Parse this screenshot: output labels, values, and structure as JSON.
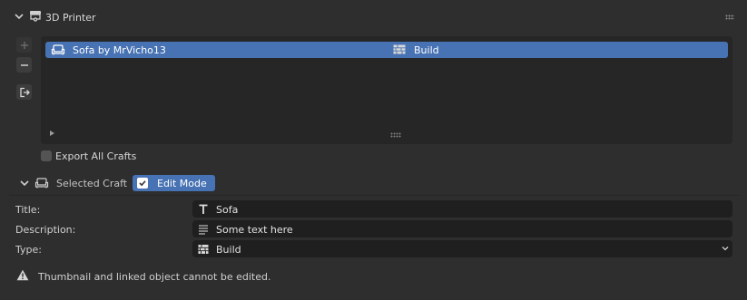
{
  "panel": {
    "title": "3D Printer",
    "header_icon": "printer-icon"
  },
  "side_buttons": [
    {
      "name": "add-button",
      "icon": "plus-icon"
    },
    {
      "name": "remove-button",
      "icon": "minus-icon"
    },
    {
      "name": "export-button",
      "icon": "export-icon"
    }
  ],
  "craft_list": {
    "items": [
      {
        "label": "Sofa by MrVicho13",
        "type": "Build",
        "icon": "sofa-icon",
        "type_icon": "brick-icon",
        "selected": true
      }
    ]
  },
  "export_all": {
    "label": "Export All Crafts",
    "checked": false
  },
  "selected_craft": {
    "label": "Selected Craft",
    "edit_mode": {
      "label": "Edit Mode",
      "checked": true
    }
  },
  "fields": {
    "title": {
      "label": "Title:",
      "value": "Sofa",
      "icon": "text-icon"
    },
    "description": {
      "label": "Description:",
      "value": "Some text here",
      "icon": "lines-icon"
    },
    "type": {
      "label": "Type:",
      "value": "Build",
      "icon": "brick-icon"
    }
  },
  "warning": {
    "text": "Thumbnail and linked object cannot be edited.",
    "icon": "warning-icon"
  },
  "colors": {
    "accent": "#4772b3",
    "background": "#2e2e2e",
    "field": "#1f1f1f"
  }
}
